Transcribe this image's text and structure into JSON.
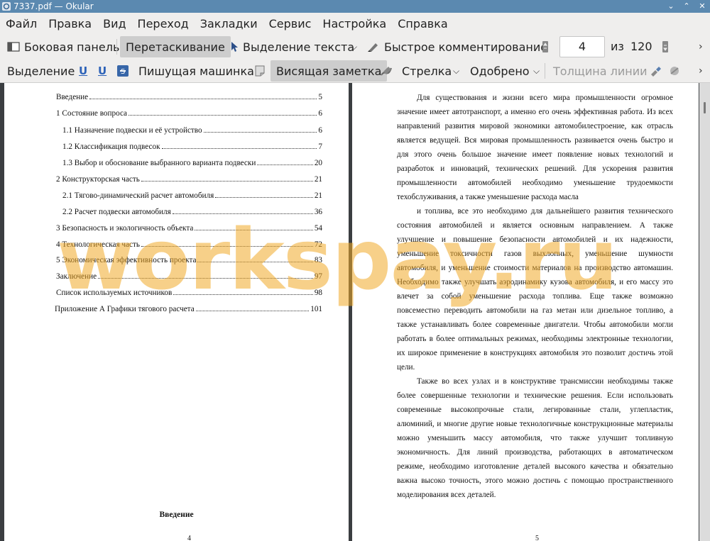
{
  "window": {
    "title": "7337.pdf  — Okular",
    "controls": [
      "⌄",
      "⌃",
      "✕"
    ]
  },
  "menubar": {
    "items": [
      "Файл",
      "Правка",
      "Вид",
      "Переход",
      "Закладки",
      "Сервис",
      "Настройка",
      "Справка"
    ]
  },
  "toolbar_main": {
    "sidebar_label": "Боковая панель",
    "browse_label": "Перетаскивание",
    "text_select_label": "Выделение текста",
    "quick_annotate_label": "Быстрое комментирование",
    "page_current": "4",
    "page_of": "из",
    "page_total": "120"
  },
  "toolbar_annot": {
    "highlight_label": "Выделение",
    "typewriter_label": "Пишущая машинка",
    "popup_note_label": "Висящая заметка",
    "arrow_label": "Стрелка",
    "stamp_label": "Одобрено",
    "line_width_label": "Толщина линии"
  },
  "page_left": {
    "toc": [
      {
        "title": "Введение",
        "page": "5"
      },
      {
        "title": "1 Состояние вопроса",
        "page": "6"
      },
      {
        "title": "1.1 Назначение подвески и её устройство",
        "page": "6"
      },
      {
        "title": "1.2 Классификация подвесок",
        "page": "7"
      },
      {
        "title": "1.3 Выбор и обоснование выбранного варианта подвески",
        "page": "20"
      },
      {
        "title": "2 Конструкторская часть",
        "page": "21"
      },
      {
        "title": "2.1 Тягово-динамический расчет автомобиля",
        "page": "21"
      },
      {
        "title": "2.2 Расчет подвески автомобиля",
        "page": "36"
      },
      {
        "title": "3 Безопасность и экологичность объекта",
        "page": "54"
      },
      {
        "title": "4 Технологическая часть",
        "page": "72"
      },
      {
        "title": "5 Экономическая эффективность проекта",
        "page": "83"
      },
      {
        "title": "Заключение",
        "page": "97"
      },
      {
        "title": "Список используемых источников",
        "page": "98"
      },
      {
        "title": "Приложение А Графики тягового расчета",
        "page": "101"
      }
    ],
    "heading": "Введение",
    "page_number": "4"
  },
  "page_right": {
    "lines": [
      "Для существования и жизни всего мира промышленности огромное",
      "значение имеет автотранспорт, а именно его очень эффективная работа. Из всех",
      "направлений развития мировой экономики автомобилестроение, как отрасль",
      "является ведущей. Вся мировая промышленность развивается очень быстро и",
      "для этого очень большое значение имеет появление новых технологий и",
      "разработок и инноваций, технических решений. Для ускорения развития",
      "промышленности автомобилей необходимо уменьшение трудоемкости",
      "техобслуживания, а также уменьшение расхода масла",
      "и топлива, все это необходимо для дальнейшего развития технического",
      "состояния автомобилей и является основным направлением. А также",
      "улучшение и повышение безопасности автомобилей и их надежности,",
      "уменьшение токсичности газов выхлопных, уменьшение шумности",
      "автомобиля, и уменьшение стоимости материалов на производство автомашин.",
      "Необходимо также улучшать аэродинамику кузова автомобиля, и его массу это",
      "влечет за собой уменьшение расхода топлива. Еще также возможно",
      "повсеместно переводить автомобили на газ метан или дизельное топливо, а",
      "также устанавливать более современные двигатели. Чтобы автомобили могли",
      "работать в более оптимальных режимах, необходимы электронные технологии,",
      "их широкое применение в конструкциях автомобиля это позволит достичь этой",
      "цели.",
      "Также во всех узлах и в конструктиве трансмиссии необходимы также",
      "более совершенные технологии и технические решения. Если использовать",
      "современные высокопрочные стали, легированные стали, углепластик,",
      "алюминий, и многие другие новые технологичные конструкционные материалы",
      "можно уменьшить массу автомобиля, что также улучшит топливную",
      "экономичность. Для линий производства, работающих в автоматическом",
      "режиме, необходимо изготовление деталей высокого качества и обязательно",
      "важна высоко точность, этого можно достичь с помощью пространственного",
      "моделирования всех деталей."
    ],
    "page_number": "5"
  },
  "watermark": "workspay.ru",
  "colors": {
    "titlebar": "#5b89b0",
    "toolbar": "#efeeed",
    "watermark": "#f0aa28"
  }
}
